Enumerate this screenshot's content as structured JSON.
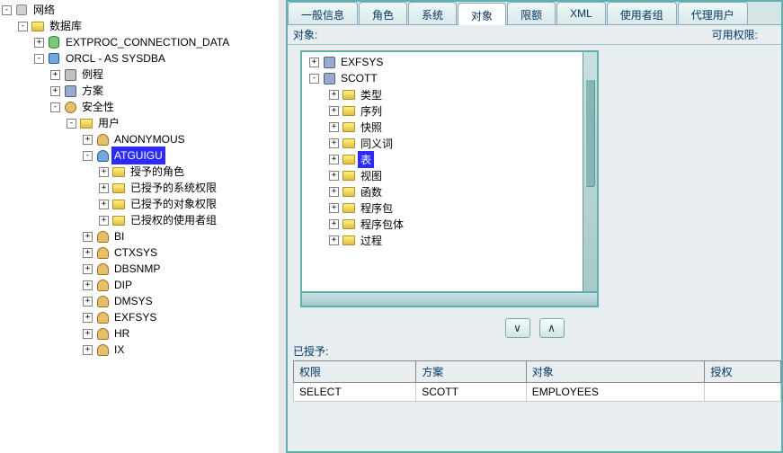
{
  "leftTree": {
    "root": "网络",
    "database": "数据库",
    "extproc": "EXTPROC_CONNECTION_DATA",
    "orcl": "ORCL - AS SYSDBA",
    "instance": "例程",
    "schema": "方案",
    "security": "安全性",
    "users": "用户",
    "userList": [
      "ANONYMOUS",
      "ATGUIGU",
      "BI",
      "CTXSYS",
      "DBSNMP",
      "DIP",
      "DMSYS",
      "EXFSYS",
      "HR",
      "IX"
    ],
    "selectedUserIndex": 1,
    "atguiguChildren": [
      "授予的角色",
      "已授予的系统权限",
      "已授予的对象权限",
      "已授权的使用者组"
    ]
  },
  "tabs": [
    "一般信息",
    "角色",
    "系统",
    "对象",
    "限额",
    "XML",
    "使用者组",
    "代理用户"
  ],
  "activeTab": 3,
  "objLabels": {
    "object": "对象:",
    "available": "可用权限:"
  },
  "objTree": {
    "schemas": [
      "EXFSYS",
      "SCOTT"
    ],
    "scottChildren": [
      "类型",
      "序列",
      "快照",
      "同义词",
      "表",
      "视图",
      "函数",
      "程序包",
      "程序包体",
      "过程"
    ],
    "selectedIndex": 4
  },
  "buttons": {
    "down": "∨",
    "up": "∧"
  },
  "granted": {
    "label": "已授予:",
    "headers": [
      "权限",
      "方案",
      "对象",
      "授权"
    ],
    "rows": [
      [
        "SELECT",
        "SCOTT",
        "EMPLOYEES",
        ""
      ]
    ]
  }
}
